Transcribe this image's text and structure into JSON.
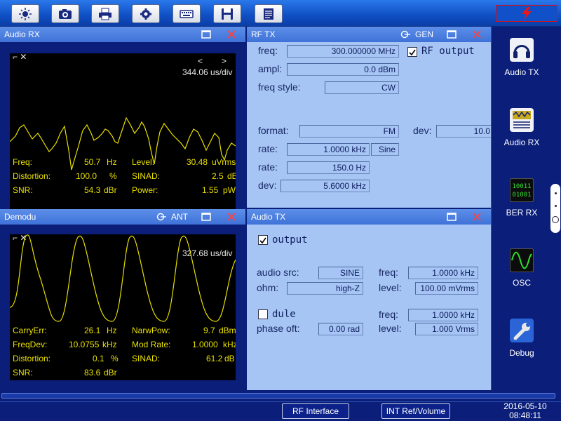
{
  "toolbar": {
    "buttons": [
      {
        "icon": "brightness-icon"
      },
      {
        "icon": "camera-icon"
      },
      {
        "icon": "print-icon"
      },
      {
        "icon": "gear-icon"
      },
      {
        "icon": "keyboard-icon"
      },
      {
        "icon": "save-icon"
      },
      {
        "icon": "document-icon"
      }
    ],
    "alarm_icon": "lightning-icon"
  },
  "audio_rx": {
    "title": "Audio RX",
    "timebase": "344.06 us/div",
    "nav_prev": "<",
    "nav_next": ">",
    "readouts": [
      {
        "label": "Freq:",
        "value": "50.7",
        "unit": "Hz"
      },
      {
        "label": "Level:",
        "value": "30.48",
        "unit": "uVrms"
      },
      {
        "label": "Distortion:",
        "value": "100.0",
        "unit": "%"
      },
      {
        "label": "SINAD:",
        "value": "2.5",
        "unit": "dB"
      },
      {
        "label": "SNR:",
        "value": "54.3",
        "unit": "dBr"
      },
      {
        "label": "Power:",
        "value": "1.55",
        "unit": "pW"
      }
    ]
  },
  "rf_tx": {
    "title": "RF TX",
    "gen_label": "GEN",
    "freq_label": "freq:",
    "freq_value": "300.000000 MHz",
    "ampl_label": "ampl:",
    "ampl_value": "0.0 dBm",
    "freq_style_label": "freq style:",
    "freq_style_value": "CW",
    "rf_output_label": "RF output",
    "rf_output_checked": true,
    "format_label": "format:",
    "format_value": "FM",
    "dev_label_right": "dev:",
    "dev_value_right": "10.0",
    "rate1_label": "rate:",
    "rate1_value": "1.0000 kHz",
    "rate1_shape": "Sine",
    "rate2_label": "rate:",
    "rate2_value": "150.0  Hz",
    "dev_label": "dev:",
    "dev_value": "5.6000 kHz"
  },
  "demodu": {
    "title": "Demodu",
    "ant_label": "ANT",
    "timebase": "327.68 us/div",
    "readouts": [
      {
        "label": "CarryErr:",
        "value": "26.1",
        "unit": "Hz"
      },
      {
        "label": "NarwPow:",
        "value": "9.7",
        "unit": "dBm"
      },
      {
        "label": "FreqDev:",
        "value": "10.0755",
        "unit": "kHz"
      },
      {
        "label": "Mod Rate:",
        "value": "1.0000",
        "unit": "kHz"
      },
      {
        "label": "Distortion:",
        "value": "0.1",
        "unit": "%"
      },
      {
        "label": "SINAD:",
        "value": "61.2",
        "unit": "dB"
      },
      {
        "label": "SNR:",
        "value": "83.6",
        "unit": "dBr"
      }
    ]
  },
  "audio_tx": {
    "title": "Audio TX",
    "output_label": "output",
    "output_checked": true,
    "audio_src_label": "audio src:",
    "audio_src_value": "SINE",
    "freq1_label": "freq:",
    "freq1_value": "1.0000 kHz",
    "ohm_label": "ohm:",
    "ohm_value": "high-Z",
    "level1_label": "level:",
    "level1_value": "100.00 mVrms",
    "dule_label": "dule",
    "dule_checked": false,
    "freq2_label": "freq:",
    "freq2_value": "1.0000 kHz",
    "phase_label": "phase oft:",
    "phase_value": "0.00 rad",
    "level2_label": "level:",
    "level2_value": "1.000  Vrms"
  },
  "right_nav": [
    {
      "label": "Audio TX",
      "icon": "headphones-icon"
    },
    {
      "label": "Audio RX",
      "icon": "audio-analyzer-icon"
    },
    {
      "label": "BER RX",
      "icon": "binary-icon"
    },
    {
      "label": "OSC",
      "icon": "oscilloscope-icon"
    },
    {
      "label": "Debug",
      "icon": "wrench-icon"
    }
  ],
  "status": {
    "rf_interface": "RF Interface",
    "int_ref": "INT Ref/Volume",
    "date": "2016-05-10",
    "time": "08:48:11"
  },
  "colors": {
    "background": "#0a1e7a",
    "panel": "#a6c4f4",
    "trace": "#e8e000",
    "close": "#ff4040"
  }
}
